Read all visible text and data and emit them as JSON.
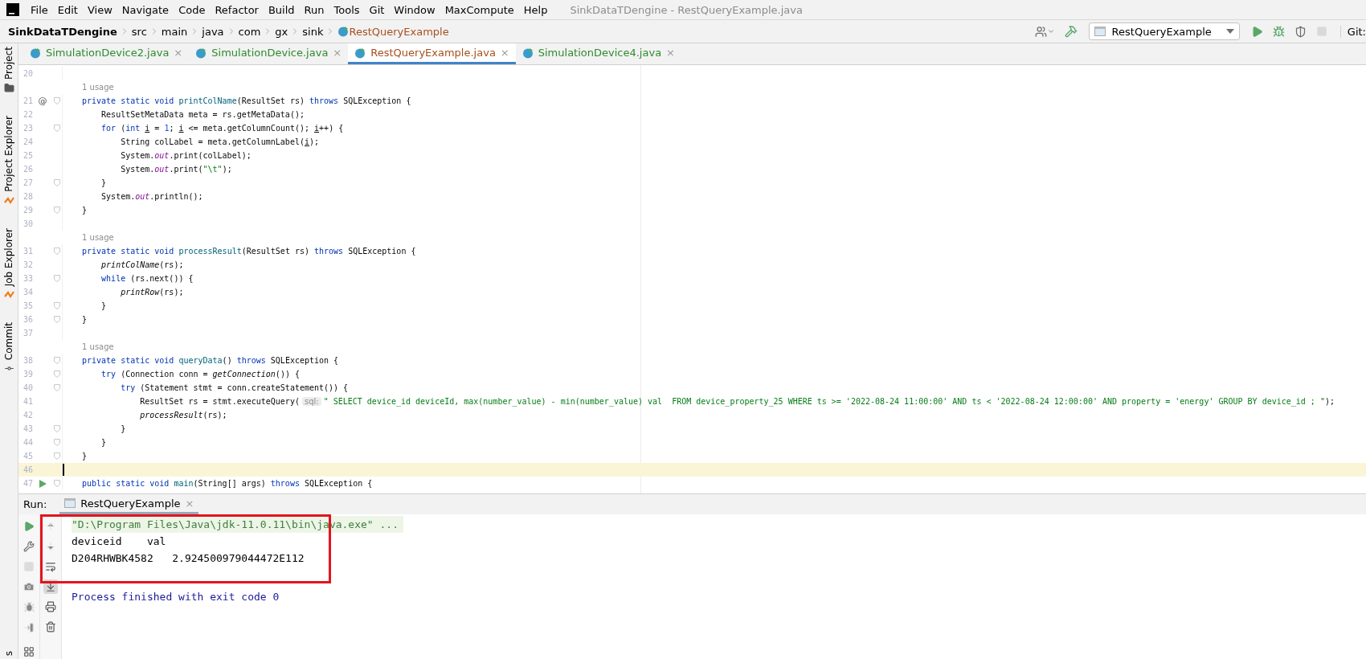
{
  "menu": {
    "items": [
      "File",
      "Edit",
      "View",
      "Navigate",
      "Code",
      "Refactor",
      "Build",
      "Run",
      "Tools",
      "Git",
      "Window",
      "MaxCompute",
      "Help"
    ],
    "title": "SinkDataTDengine - RestQueryExample.java"
  },
  "breadcrumbs": [
    {
      "kind": "project",
      "text": "SinkDataTDengine"
    },
    {
      "kind": "folder",
      "text": "src"
    },
    {
      "kind": "folder",
      "text": "main"
    },
    {
      "kind": "folder",
      "text": "java"
    },
    {
      "kind": "folder",
      "text": "com"
    },
    {
      "kind": "folder",
      "text": "gx"
    },
    {
      "kind": "folder",
      "text": "sink"
    },
    {
      "kind": "class",
      "text": "RestQueryExample"
    }
  ],
  "toolbar": {
    "items": [
      {
        "kind": "user",
        "disabled": false
      },
      {
        "kind": "build",
        "disabled": false
      },
      {
        "kind": "config",
        "text": "RestQueryExample",
        "disabled": false
      },
      {
        "kind": "run",
        "disabled": false
      },
      {
        "kind": "debug",
        "disabled": false
      },
      {
        "kind": "coverage",
        "disabled": false
      },
      {
        "kind": "stop",
        "disabled": true
      }
    ],
    "git": "Git:"
  },
  "strip": [
    {
      "kind": "project",
      "text": "Project"
    },
    {
      "kind": "explorer",
      "text": "Project Explorer"
    },
    {
      "kind": "explorer",
      "text": "Job Explorer"
    },
    {
      "kind": "commit",
      "text": "Commit"
    },
    {
      "kind": "cut",
      "text": "s"
    }
  ],
  "tabs": [
    {
      "label": "SimulationDevice2.java",
      "close": "×",
      "selected": false,
      "color": "#2e8b2e"
    },
    {
      "label": "SimulationDevice.java",
      "close": "×",
      "selected": false,
      "color": "#2e8b2e"
    },
    {
      "label": "RestQueryExample.java",
      "close": "×",
      "selected": true,
      "color": "#a8501c"
    },
    {
      "label": "SimulationDevice4.java",
      "close": "×",
      "selected": false,
      "color": "#2e8b2e"
    }
  ],
  "code": {
    "lines": [
      {
        "kind": "code",
        "number": "20",
        "fold": false,
        "current": false
      },
      {
        "kind": "usage",
        "text": "1 usage"
      },
      {
        "kind": "code",
        "number": "21",
        "marker": "@",
        "fold": true,
        "current": false,
        "segments": [
          {
            "kind": "kw",
            "text": "private static void "
          },
          {
            "kind": "fn",
            "text": "printColName"
          },
          {
            "kind": "plain",
            "text": "(ResultSet rs) "
          },
          {
            "kind": "kw",
            "text": "throws"
          },
          {
            "kind": "plain",
            "text": " SQLException {"
          }
        ]
      },
      {
        "kind": "code",
        "number": "22",
        "fold": false,
        "current": false,
        "segments": [
          {
            "kind": "plain",
            "text": "    ResultSetMetaData meta = rs.getMetaData();"
          }
        ]
      },
      {
        "kind": "code",
        "number": "23",
        "fold": true,
        "current": false,
        "segments": [
          {
            "kind": "kw",
            "text": "    for"
          },
          {
            "kind": "plain",
            "text": " ("
          },
          {
            "kind": "kw",
            "text": "int "
          },
          {
            "kind": "var",
            "text": "i"
          },
          {
            "kind": "plain",
            "text": " = "
          },
          {
            "kind": "num",
            "text": "1"
          },
          {
            "kind": "plain",
            "text": "; "
          },
          {
            "kind": "var",
            "text": "i"
          },
          {
            "kind": "plain",
            "text": " <= meta.getColumnCount(); "
          },
          {
            "kind": "var",
            "text": "i"
          },
          {
            "kind": "plain",
            "text": "++) {"
          }
        ]
      },
      {
        "kind": "code",
        "number": "24",
        "fold": false,
        "current": false,
        "segments": [
          {
            "kind": "plain",
            "text": "        String colLabel = meta.getColumnLabel("
          },
          {
            "kind": "var",
            "text": "i"
          },
          {
            "kind": "plain",
            "text": ");"
          }
        ]
      },
      {
        "kind": "code",
        "number": "25",
        "fold": false,
        "current": false,
        "segments": [
          {
            "kind": "plain",
            "text": "        System."
          },
          {
            "kind": "field",
            "text": "out"
          },
          {
            "kind": "plain",
            "text": ".print(colLabel);"
          }
        ]
      },
      {
        "kind": "code",
        "number": "26",
        "fold": false,
        "current": false,
        "segments": [
          {
            "kind": "plain",
            "text": "        System."
          },
          {
            "kind": "field",
            "text": "out"
          },
          {
            "kind": "plain",
            "text": ".print("
          },
          {
            "kind": "str",
            "text": "\"\\t\""
          },
          {
            "kind": "plain",
            "text": ");"
          }
        ]
      },
      {
        "kind": "code",
        "number": "27",
        "fold": true,
        "current": false,
        "segments": [
          {
            "kind": "plain",
            "text": "    }"
          }
        ]
      },
      {
        "kind": "code",
        "number": "28",
        "fold": false,
        "current": false,
        "segments": [
          {
            "kind": "plain",
            "text": "    System."
          },
          {
            "kind": "field",
            "text": "out"
          },
          {
            "kind": "plain",
            "text": ".println();"
          }
        ]
      },
      {
        "kind": "code",
        "number": "29",
        "fold": true,
        "current": false,
        "segments": [
          {
            "kind": "plain",
            "text": "}"
          }
        ]
      },
      {
        "kind": "code",
        "number": "30",
        "fold": false,
        "current": false
      },
      {
        "kind": "usage",
        "text": "1 usage"
      },
      {
        "kind": "code",
        "number": "31",
        "fold": true,
        "current": false,
        "segments": [
          {
            "kind": "kw",
            "text": "private static void "
          },
          {
            "kind": "fn",
            "text": "processResult"
          },
          {
            "kind": "plain",
            "text": "(ResultSet rs) "
          },
          {
            "kind": "kw",
            "text": "throws"
          },
          {
            "kind": "plain",
            "text": " SQLException {"
          }
        ]
      },
      {
        "kind": "code",
        "number": "32",
        "fold": false,
        "current": false,
        "segments": [
          {
            "kind": "call",
            "text": "    printColName"
          },
          {
            "kind": "plain",
            "text": "(rs);"
          }
        ]
      },
      {
        "kind": "code",
        "number": "33",
        "fold": true,
        "current": false,
        "segments": [
          {
            "kind": "kw",
            "text": "    while"
          },
          {
            "kind": "plain",
            "text": " (rs.next()) {"
          }
        ]
      },
      {
        "kind": "code",
        "number": "34",
        "fold": false,
        "current": false,
        "segments": [
          {
            "kind": "call",
            "text": "        printRow"
          },
          {
            "kind": "plain",
            "text": "(rs);"
          }
        ]
      },
      {
        "kind": "code",
        "number": "35",
        "fold": true,
        "current": false,
        "segments": [
          {
            "kind": "plain",
            "text": "    }"
          }
        ]
      },
      {
        "kind": "code",
        "number": "36",
        "fold": true,
        "current": false,
        "segments": [
          {
            "kind": "plain",
            "text": "}"
          }
        ]
      },
      {
        "kind": "code",
        "number": "37",
        "fold": false,
        "current": false
      },
      {
        "kind": "usage",
        "text": "1 usage"
      },
      {
        "kind": "code",
        "number": "38",
        "fold": true,
        "current": false,
        "segments": [
          {
            "kind": "kw",
            "text": "private static void "
          },
          {
            "kind": "fn",
            "text": "queryData"
          },
          {
            "kind": "plain",
            "text": "() "
          },
          {
            "kind": "kw",
            "text": "throws"
          },
          {
            "kind": "plain",
            "text": " SQLException {"
          }
        ]
      },
      {
        "kind": "code",
        "number": "39",
        "fold": true,
        "current": false,
        "segments": [
          {
            "kind": "kw",
            "text": "    try"
          },
          {
            "kind": "plain",
            "text": " (Connection conn = "
          },
          {
            "kind": "call",
            "text": "getConnection"
          },
          {
            "kind": "plain",
            "text": "()) {"
          }
        ]
      },
      {
        "kind": "code",
        "number": "40",
        "fold": true,
        "current": false,
        "segments": [
          {
            "kind": "kw",
            "text": "        try"
          },
          {
            "kind": "plain",
            "text": " (Statement stmt = conn.createStatement()) {"
          }
        ]
      },
      {
        "kind": "code",
        "number": "41",
        "fold": false,
        "current": false,
        "segments": [
          {
            "kind": "plain",
            "text": "            ResultSet rs = stmt.executeQuery("
          },
          {
            "kind": "hint",
            "text": "sql:"
          },
          {
            "kind": "str",
            "text": "\" SELECT device_id deviceId, max(number_value) - min(number_value) val  FROM device_property_25 WHERE ts >= '2022-08-24 11:00:00' AND ts < '2022-08-24 12:00:00' AND property = 'energy' GROUP BY device_id ; \""
          },
          {
            "kind": "plain",
            "text": ");"
          }
        ]
      },
      {
        "kind": "code",
        "number": "42",
        "fold": false,
        "current": false,
        "segments": [
          {
            "kind": "call",
            "text": "            processResult"
          },
          {
            "kind": "plain",
            "text": "(rs);"
          }
        ]
      },
      {
        "kind": "code",
        "number": "43",
        "fold": true,
        "current": false,
        "segments": [
          {
            "kind": "plain",
            "text": "        }"
          }
        ]
      },
      {
        "kind": "code",
        "number": "44",
        "fold": true,
        "current": false,
        "segments": [
          {
            "kind": "plain",
            "text": "    }"
          }
        ]
      },
      {
        "kind": "code",
        "number": "45",
        "fold": true,
        "current": false,
        "segments": [
          {
            "kind": "plain",
            "text": "}"
          }
        ]
      },
      {
        "kind": "code",
        "number": "46",
        "fold": false,
        "current": true
      },
      {
        "kind": "code",
        "number": "47",
        "run": true,
        "fold": true,
        "current": false,
        "segments": [
          {
            "kind": "kw",
            "text": "public static void "
          },
          {
            "kind": "fn",
            "text": "main"
          },
          {
            "kind": "plain",
            "text": "(String[] args) "
          },
          {
            "kind": "kw",
            "text": "throws"
          },
          {
            "kind": "plain",
            "text": " SQLException {"
          }
        ]
      }
    ]
  },
  "run_panel": {
    "title": "Run:",
    "tab": {
      "label": "RestQueryExample",
      "close": "×",
      "selected": true
    },
    "actions": [
      {
        "kind": "rerun",
        "disabled": false
      },
      {
        "kind": "settings",
        "disabled": false
      },
      {
        "kind": "stop",
        "disabled": true
      },
      {
        "kind": "snapshot",
        "disabled": true
      },
      {
        "kind": "debug",
        "disabled": true
      },
      {
        "kind": "attach",
        "disabled": true
      },
      {
        "kind": "layout",
        "disabled": false
      }
    ],
    "console_tools": [
      {
        "kind": "up",
        "disabled": true,
        "selected": false
      },
      {
        "kind": "down",
        "disabled": true,
        "selected": false
      },
      {
        "kind": "wrap",
        "disabled": false,
        "selected": false
      },
      {
        "kind": "scroll-end",
        "disabled": false,
        "selected": true
      },
      {
        "kind": "print",
        "disabled": false,
        "selected": false
      },
      {
        "kind": "clear",
        "disabled": false,
        "selected": false
      }
    ],
    "output": [
      {
        "kind": "command",
        "text": "\"D:\\Program Files\\Java\\jdk-11.0.11\\bin\\java.exe\" ..."
      },
      {
        "kind": "stdout",
        "text": "deviceid    val"
      },
      {
        "kind": "stdout",
        "text": "D204RHWBK4582   2.924500979044472E112"
      },
      {
        "kind": "system",
        "text": "Process finished with exit code 0"
      }
    ],
    "highlight": true
  }
}
